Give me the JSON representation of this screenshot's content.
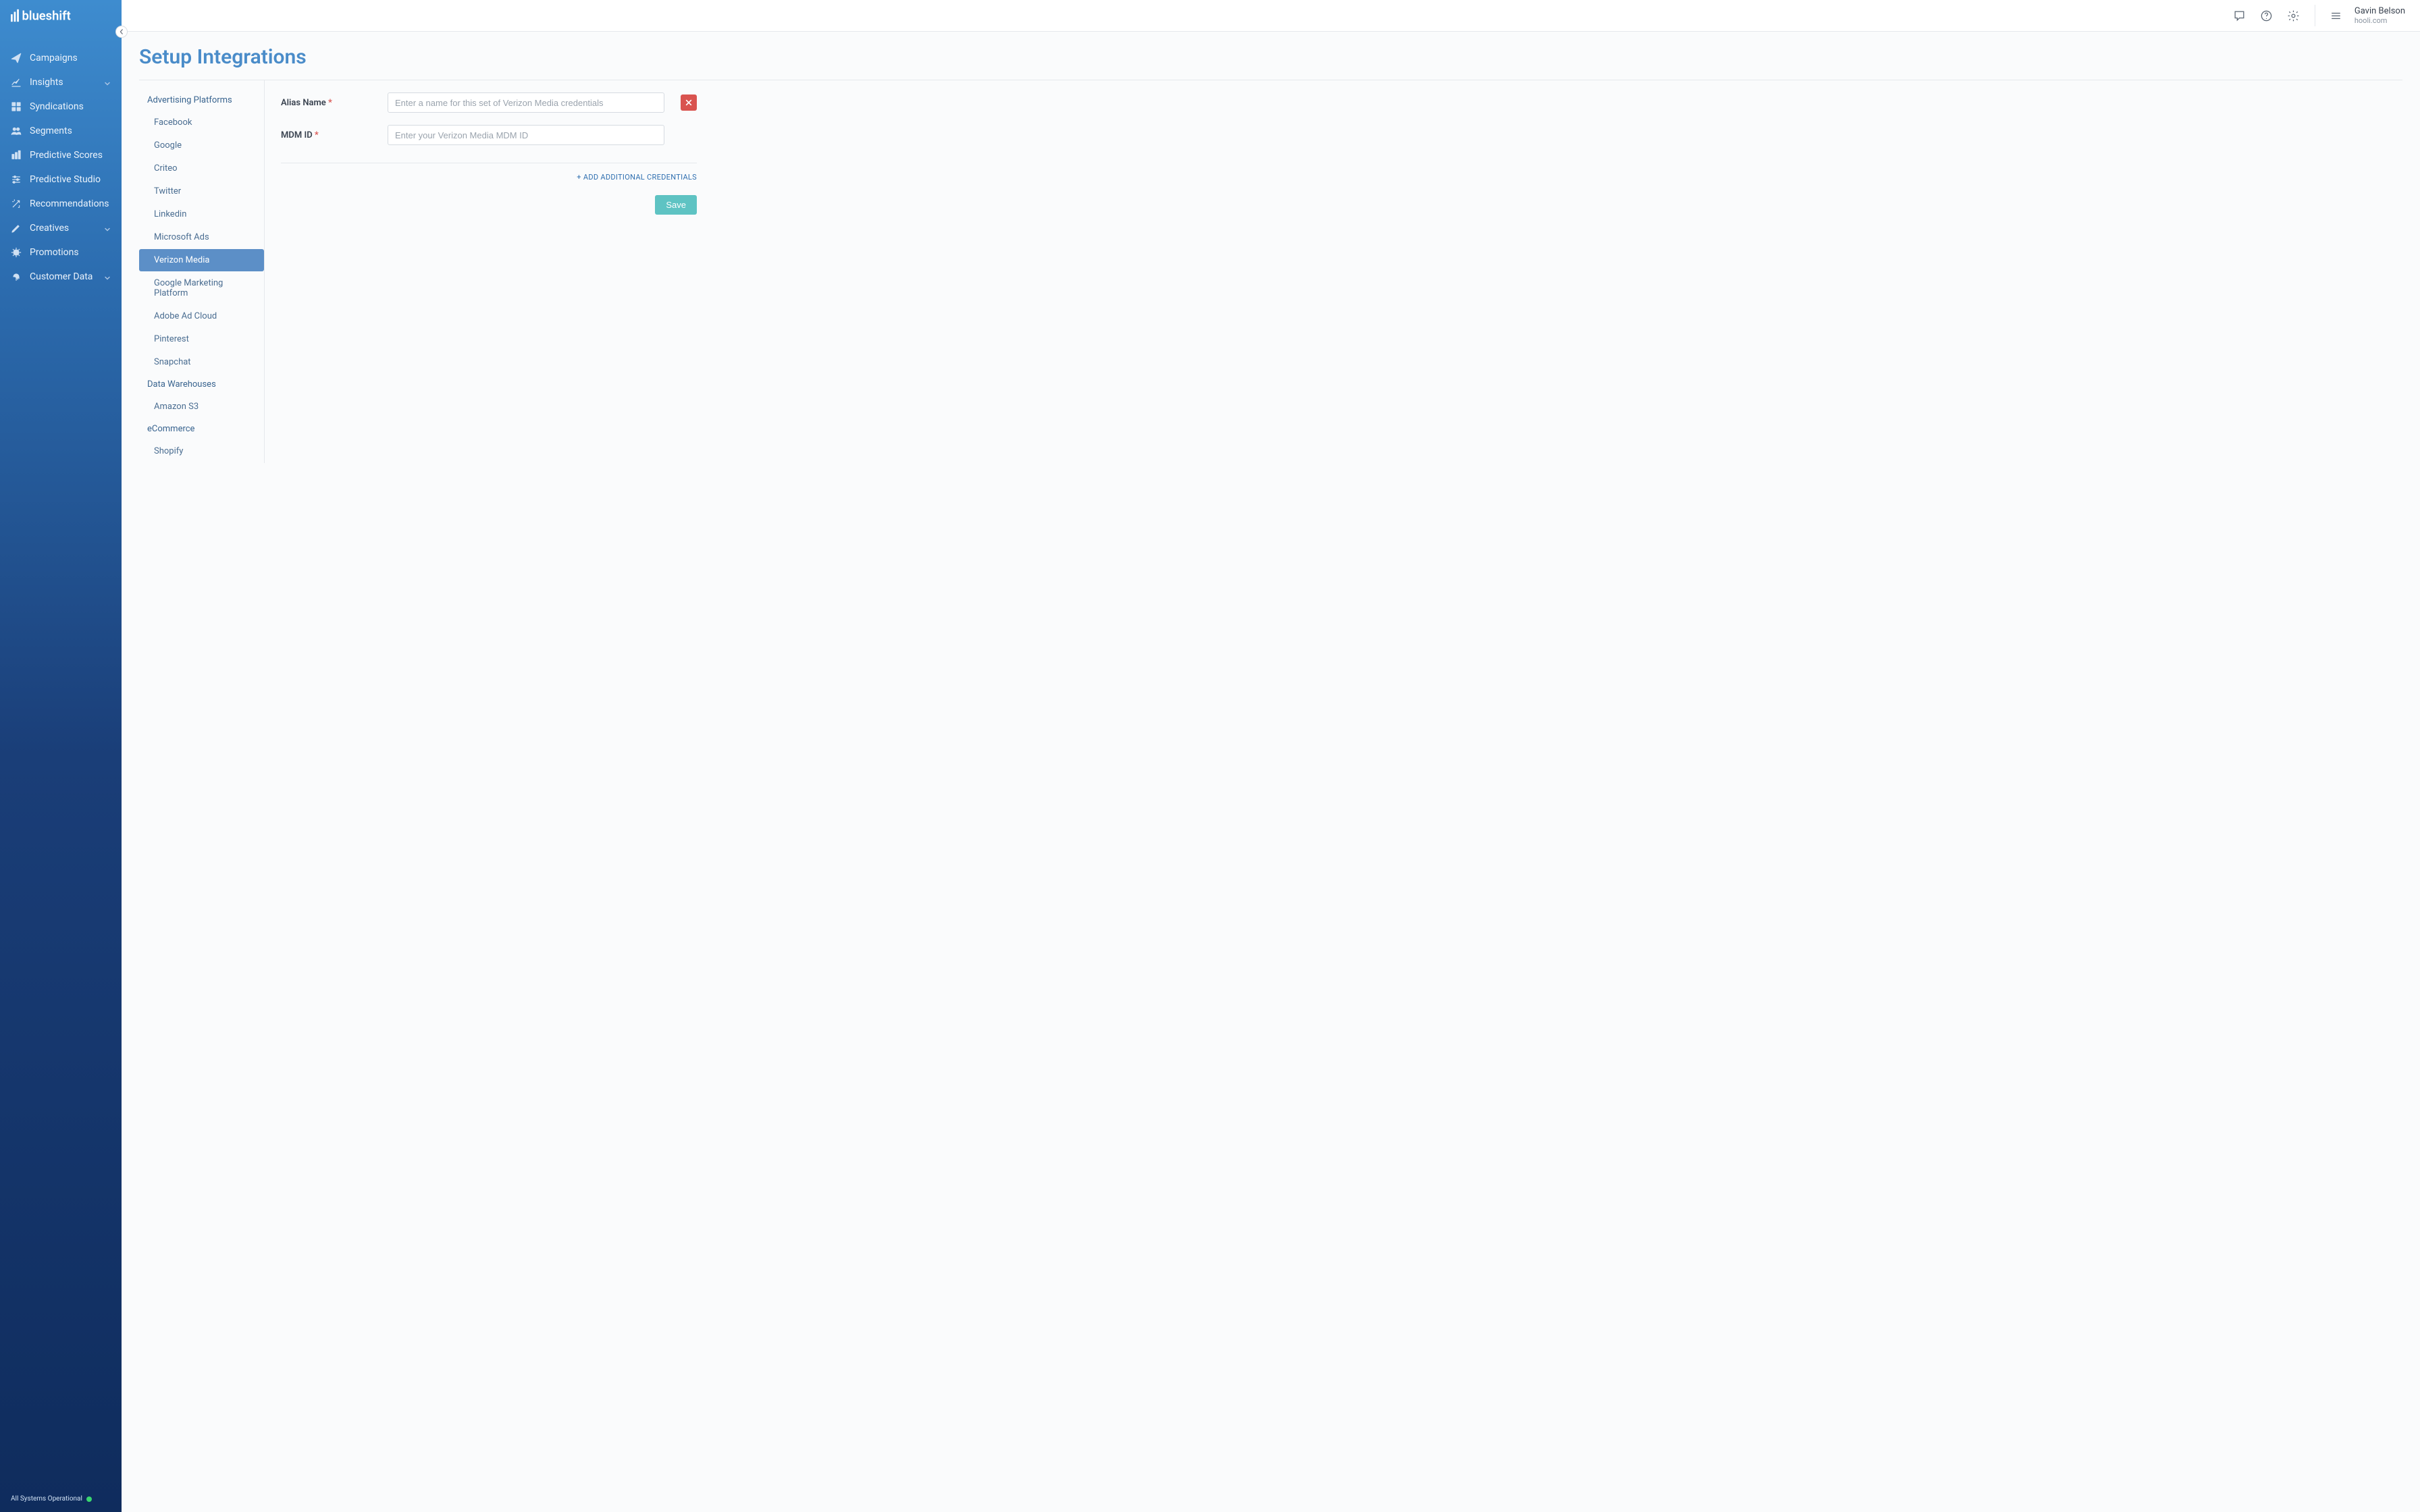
{
  "brand": "blueshift",
  "sidebar": {
    "items": [
      {
        "label": "Campaigns",
        "icon": "paper-plane",
        "expandable": false
      },
      {
        "label": "Insights",
        "icon": "chart-line",
        "expandable": true
      },
      {
        "label": "Syndications",
        "icon": "grid",
        "expandable": false
      },
      {
        "label": "Segments",
        "icon": "users",
        "expandable": false
      },
      {
        "label": "Predictive Scores",
        "icon": "bars",
        "expandable": false
      },
      {
        "label": "Predictive Studio",
        "icon": "sliders",
        "expandable": false
      },
      {
        "label": "Recommendations",
        "icon": "wand",
        "expandable": false
      },
      {
        "label": "Creatives",
        "icon": "pen",
        "expandable": true
      },
      {
        "label": "Promotions",
        "icon": "badge",
        "expandable": false
      },
      {
        "label": "Customer Data",
        "icon": "fingerprint",
        "expandable": true
      }
    ],
    "status": "All Systems Operational"
  },
  "topbar": {
    "user_name": "Gavin Belson",
    "user_org": "hooli.com"
  },
  "page": {
    "title": "Setup Integrations"
  },
  "subnav": {
    "groups": [
      {
        "title": "Advertising Platforms",
        "items": [
          {
            "label": "Facebook"
          },
          {
            "label": "Google"
          },
          {
            "label": "Criteo"
          },
          {
            "label": "Twitter"
          },
          {
            "label": "Linkedin"
          },
          {
            "label": "Microsoft Ads"
          },
          {
            "label": "Verizon Media",
            "active": true
          },
          {
            "label": "Google Marketing Platform"
          },
          {
            "label": "Adobe Ad Cloud"
          },
          {
            "label": "Pinterest"
          },
          {
            "label": "Snapchat"
          }
        ]
      },
      {
        "title": "Data Warehouses",
        "items": [
          {
            "label": "Amazon S3"
          }
        ]
      },
      {
        "title": "eCommerce",
        "items": [
          {
            "label": "Shopify"
          }
        ]
      }
    ]
  },
  "form": {
    "alias_label": "Alias Name",
    "alias_placeholder": "Enter a name for this set of Verizon Media credentials",
    "mdm_label": "MDM ID",
    "mdm_placeholder": "Enter your Verizon Media MDM ID",
    "add_link": "+ ADD ADDITIONAL CREDENTIALS",
    "save_label": "Save"
  }
}
